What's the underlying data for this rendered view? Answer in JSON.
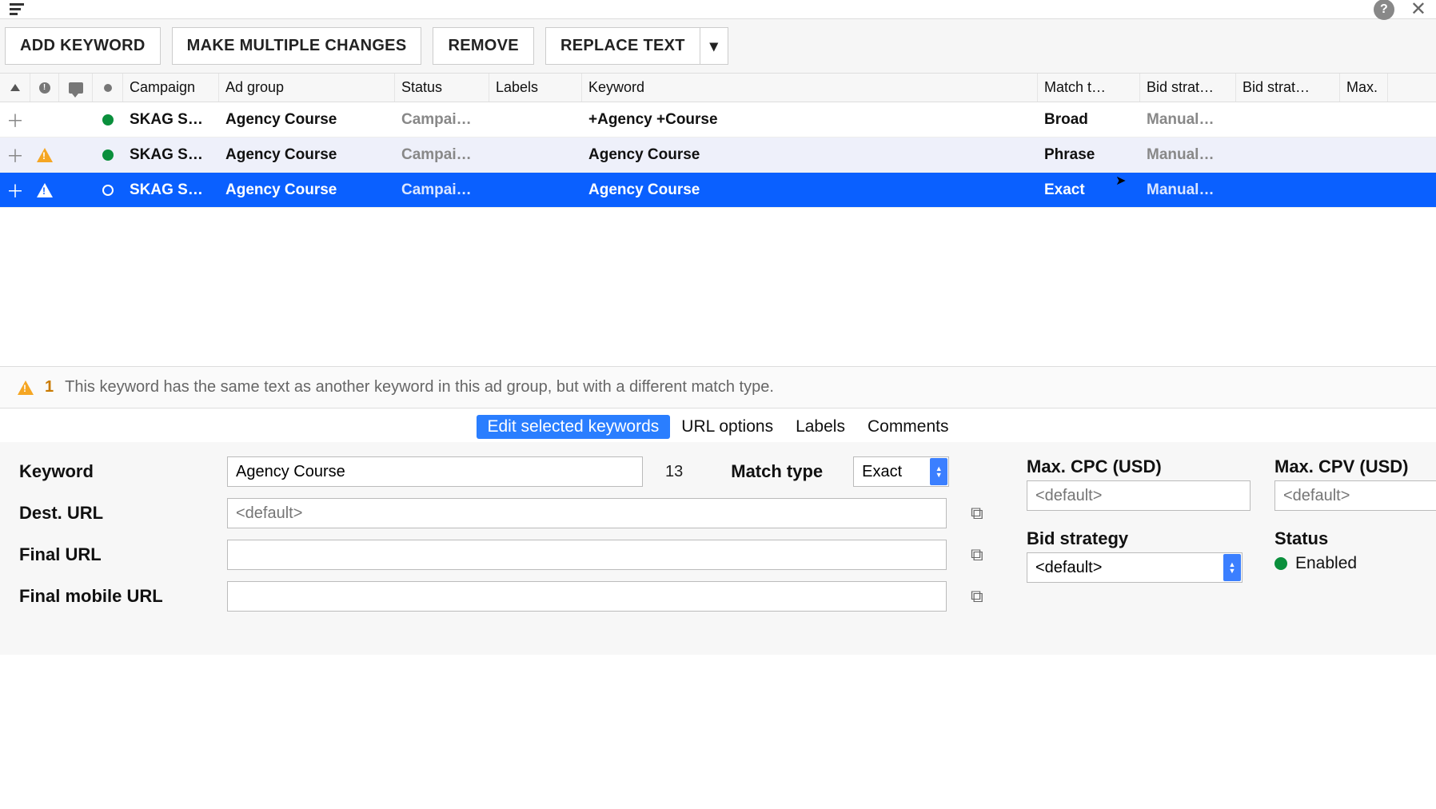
{
  "toolbar": {
    "add_keyword": "ADD KEYWORD",
    "make_multiple": "MAKE MULTIPLE CHANGES",
    "remove": "REMOVE",
    "replace_text": "REPLACE TEXT"
  },
  "columns": {
    "campaign": "Campaign",
    "adgroup": "Ad group",
    "status": "Status",
    "labels": "Labels",
    "keyword": "Keyword",
    "match": "Match t…",
    "bid1": "Bid strat…",
    "bid2": "Bid strat…",
    "max": "Max."
  },
  "rows": [
    {
      "campaign": "SKAG S…",
      "adgroup": "Agency Course",
      "status": "Campai…",
      "keyword": "+Agency +Course",
      "match": "Broad",
      "bid": "Manual…",
      "warn": false,
      "selected": false,
      "dot": "green"
    },
    {
      "campaign": "SKAG S…",
      "adgroup": "Agency Course",
      "status": "Campai…",
      "keyword": "Agency Course",
      "match": "Phrase",
      "bid": "Manual…",
      "warn": true,
      "selected": false,
      "dot": "green",
      "alt": true
    },
    {
      "campaign": "SKAG S…",
      "adgroup": "Agency Course",
      "status": "Campai…",
      "keyword": "Agency Course",
      "match": "Exact",
      "bid": "Manual…",
      "warn": true,
      "selected": true,
      "dot": "white"
    }
  ],
  "warning": {
    "count": "1",
    "text": "This keyword has the same text as another keyword in this ad group, but with a different match type."
  },
  "tabs": {
    "edit": "Edit selected keywords",
    "url": "URL options",
    "labels": "Labels",
    "comments": "Comments"
  },
  "panel": {
    "keyword_label": "Keyword",
    "keyword_value": "Agency Course",
    "char_count": "13",
    "match_label": "Match type",
    "match_value": "Exact",
    "dest_label": "Dest. URL",
    "dest_placeholder": "<default>",
    "final_label": "Final URL",
    "final_mobile_label": "Final mobile URL",
    "max_cpc_label": "Max. CPC (USD)",
    "max_cpc_placeholder": "<default>",
    "max_cpv_label": "Max. CPV (USD)",
    "max_cpv_placeholder": "<default>",
    "bid_label": "Bid strategy",
    "bid_value": "<default>",
    "status_label": "Status",
    "status_value": "Enabled"
  }
}
